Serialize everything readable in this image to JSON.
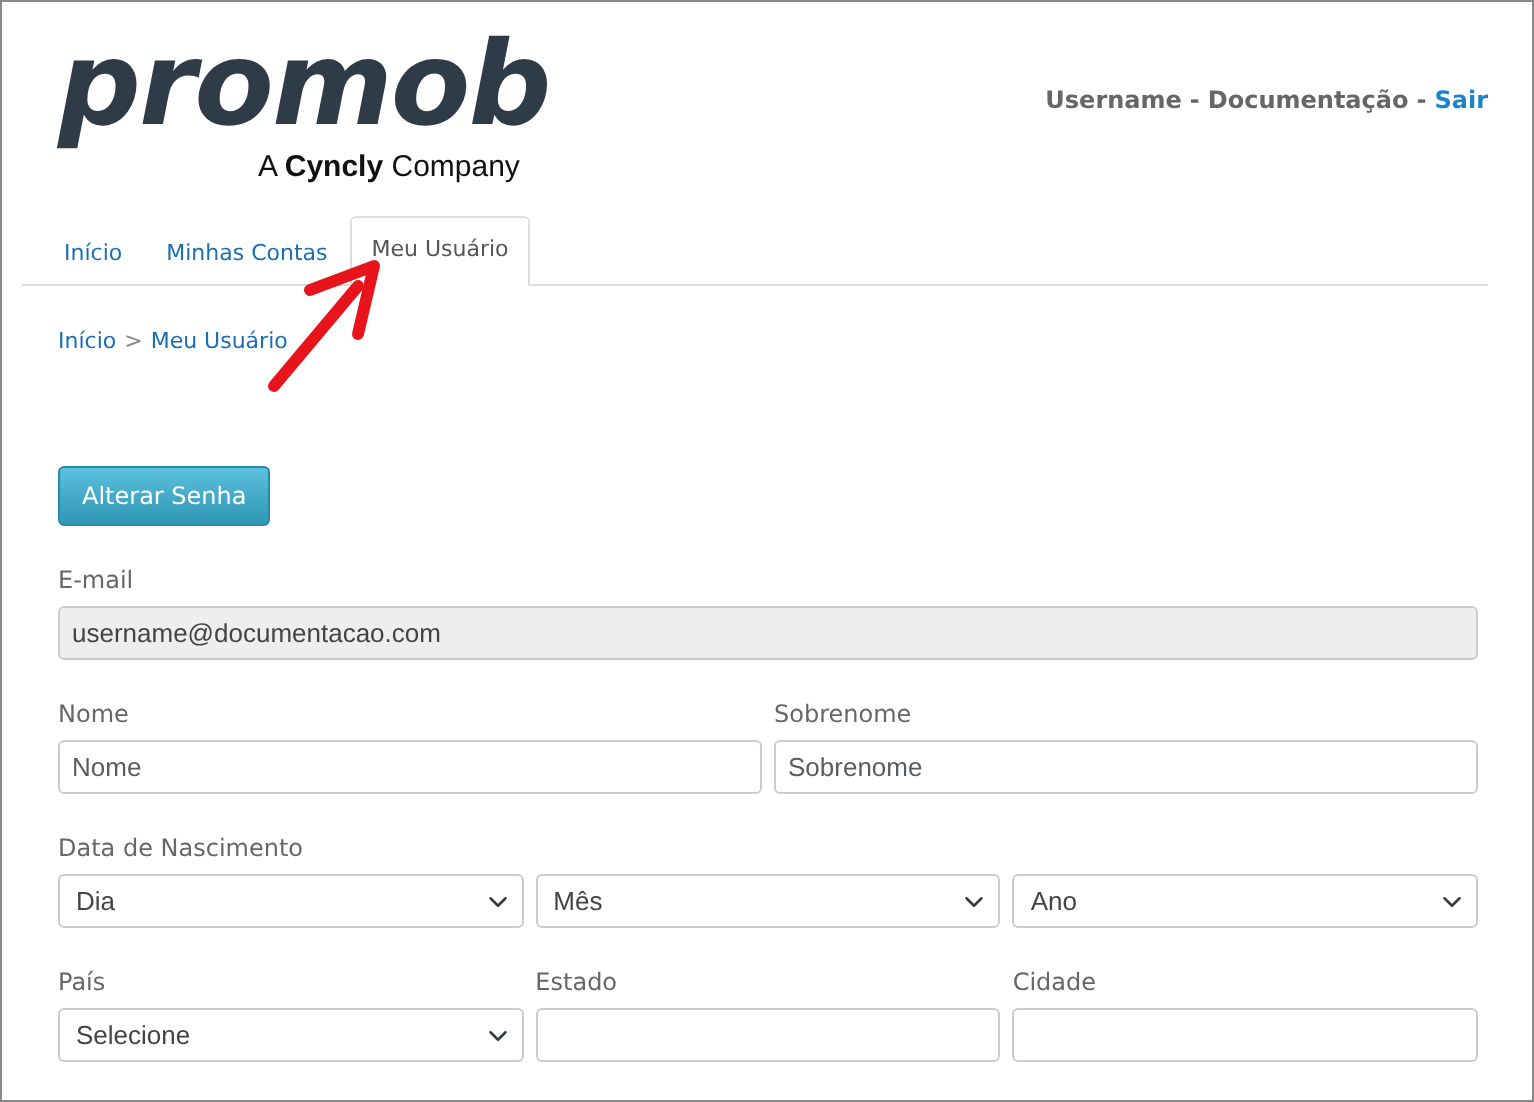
{
  "logo": {
    "wordmark": "promob",
    "tagline": "A **Cyncly** Company"
  },
  "user_bar": [
    {
      "kind": "text",
      "text": "Username"
    },
    {
      "kind": "text",
      "text": "-"
    },
    {
      "kind": "text",
      "text": "Documentação"
    },
    {
      "kind": "text",
      "text": "-"
    },
    {
      "kind": "link",
      "text": "Sair"
    }
  ],
  "tabs": [
    {
      "label": "Início",
      "selected": false
    },
    {
      "label": "Minhas Contas",
      "selected": false
    },
    {
      "label": "Meu Usuário",
      "selected": true
    }
  ],
  "annotation": {
    "kind": "arrow"
  },
  "breadcrumb": {
    "items": [
      "Início",
      "Meu Usuário"
    ],
    "separator": ">"
  },
  "change_password_button": "Alterar Senha",
  "form_rows": [
    {
      "fields": [
        {
          "kind": "text",
          "label": "E-mail",
          "value": "username@documentacao.com",
          "disabled": true
        }
      ]
    },
    {
      "fields": [
        {
          "kind": "text",
          "label": "Nome",
          "placeholder": "Nome",
          "disabled": false
        },
        {
          "kind": "text",
          "label": "Sobrenome",
          "placeholder": "Sobrenome",
          "disabled": false
        }
      ]
    },
    {
      "label": "Data de Nascimento",
      "fields": [
        {
          "kind": "select",
          "value": "Dia"
        },
        {
          "kind": "select",
          "value": "Mês"
        },
        {
          "kind": "select",
          "value": "Ano"
        }
      ]
    },
    {
      "fields": [
        {
          "kind": "select",
          "label": "País",
          "value": "Selecione"
        },
        {
          "kind": "text",
          "label": "Estado",
          "disabled": false
        },
        {
          "kind": "text",
          "label": "Cidade",
          "disabled": false
        }
      ]
    }
  ]
}
